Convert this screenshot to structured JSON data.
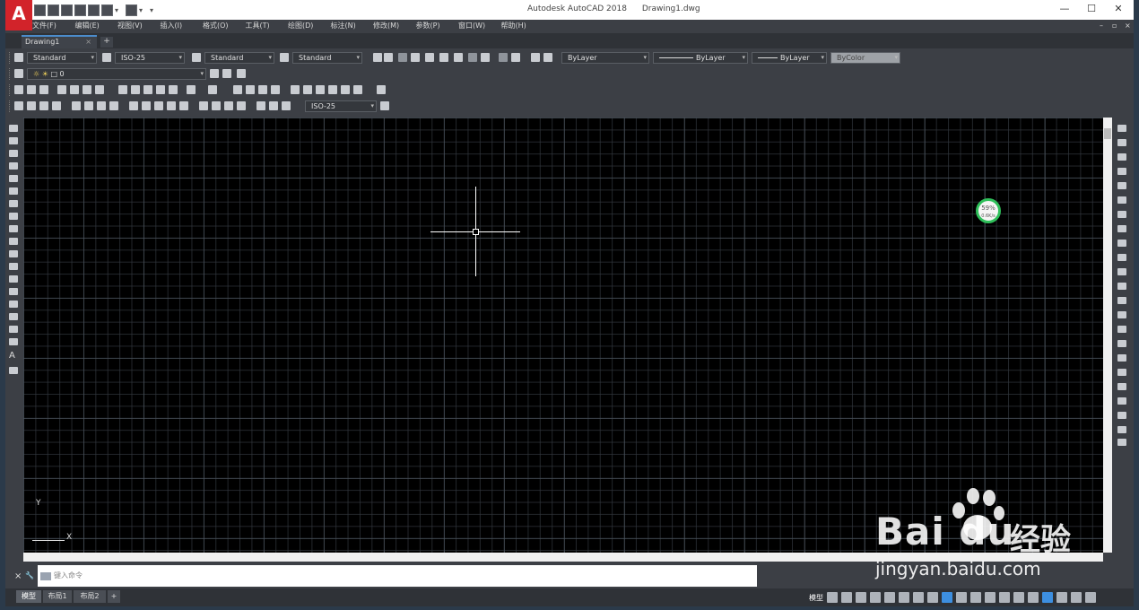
{
  "window": {
    "app_title": "Autodesk AutoCAD 2018",
    "doc_title": "Drawing1.dwg",
    "logo_letter": "A",
    "controls": {
      "minimize": "—",
      "maximize": "☐",
      "close": "✕"
    }
  },
  "menu": {
    "items": [
      "文件(F)",
      "编辑(E)",
      "视图(V)",
      "插入(I)",
      "格式(O)",
      "工具(T)",
      "绘图(D)",
      "标注(N)",
      "修改(M)",
      "参数(P)",
      "窗口(W)",
      "帮助(H)"
    ],
    "doc_controls": {
      "minimize": "–",
      "restore": "▫",
      "close": "×"
    }
  },
  "tabs": {
    "active": "Drawing1",
    "close": "×",
    "add": "+"
  },
  "styles_toolbar": {
    "text_style": "Standard",
    "dim_style": "ISO-25",
    "table_style": "Standard",
    "mleader_style": "Standard"
  },
  "properties_toolbar": {
    "layer_color": "ByLayer",
    "linetype": "ByLayer",
    "lineweight": "ByLayer",
    "plot_style": "ByColor"
  },
  "layer_toolbar": {
    "current_layer": "0"
  },
  "dim_toolbar": {
    "dim_style": "ISO-25"
  },
  "drawing": {
    "ucs_x": "X",
    "ucs_y": "Y",
    "perf_gadget": {
      "percent": "59%",
      "sub": "0.6K/s"
    }
  },
  "command_line": {
    "close": "×",
    "customize": "🔧",
    "placeholder": "键入命令"
  },
  "layout_tabs": [
    "模型",
    "布局1",
    "布局2",
    "+"
  ],
  "status_bar": {
    "model_label": "模型",
    "colors": {
      "active_icon": "#3d8fe0"
    }
  },
  "watermark": {
    "brand": "Bai du",
    "cn": "经验",
    "url": "jingyan.baidu.com"
  }
}
